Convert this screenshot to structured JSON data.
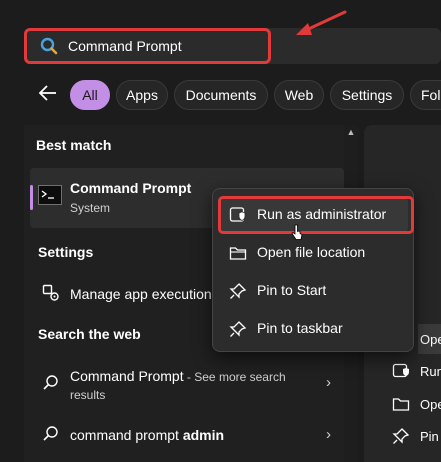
{
  "search": {
    "query": "Command Prompt",
    "icon": "search-icon"
  },
  "filters": [
    "All",
    "Apps",
    "Documents",
    "Web",
    "Settings",
    "Fol"
  ],
  "best_match": {
    "heading": "Best match",
    "title": "Command Prompt",
    "subtitle": "System",
    "icon": "command-prompt-icon"
  },
  "settings": {
    "heading": "Settings",
    "items": [
      {
        "label": "Manage app execution",
        "icon": "app-settings-icon"
      }
    ]
  },
  "search_web": {
    "heading": "Search the web",
    "items": [
      {
        "bold": "Command Prompt",
        "rest": " - See more search",
        "rest2": "results"
      },
      {
        "normal": "command prompt ",
        "bold": "admin"
      }
    ]
  },
  "context_menu": {
    "items": [
      {
        "label": "Run as administrator",
        "icon": "shield-icon"
      },
      {
        "label": "Open file location",
        "icon": "folder-icon"
      },
      {
        "label": "Pin to Start",
        "icon": "pin-icon"
      },
      {
        "label": "Pin to taskbar",
        "icon": "pin-icon"
      }
    ]
  },
  "right_panel": {
    "items": [
      "Ope",
      "Run",
      "Ope",
      "Pin"
    ]
  },
  "colors": {
    "accent": "#c38ee6",
    "annotation": "#e23a3a"
  }
}
